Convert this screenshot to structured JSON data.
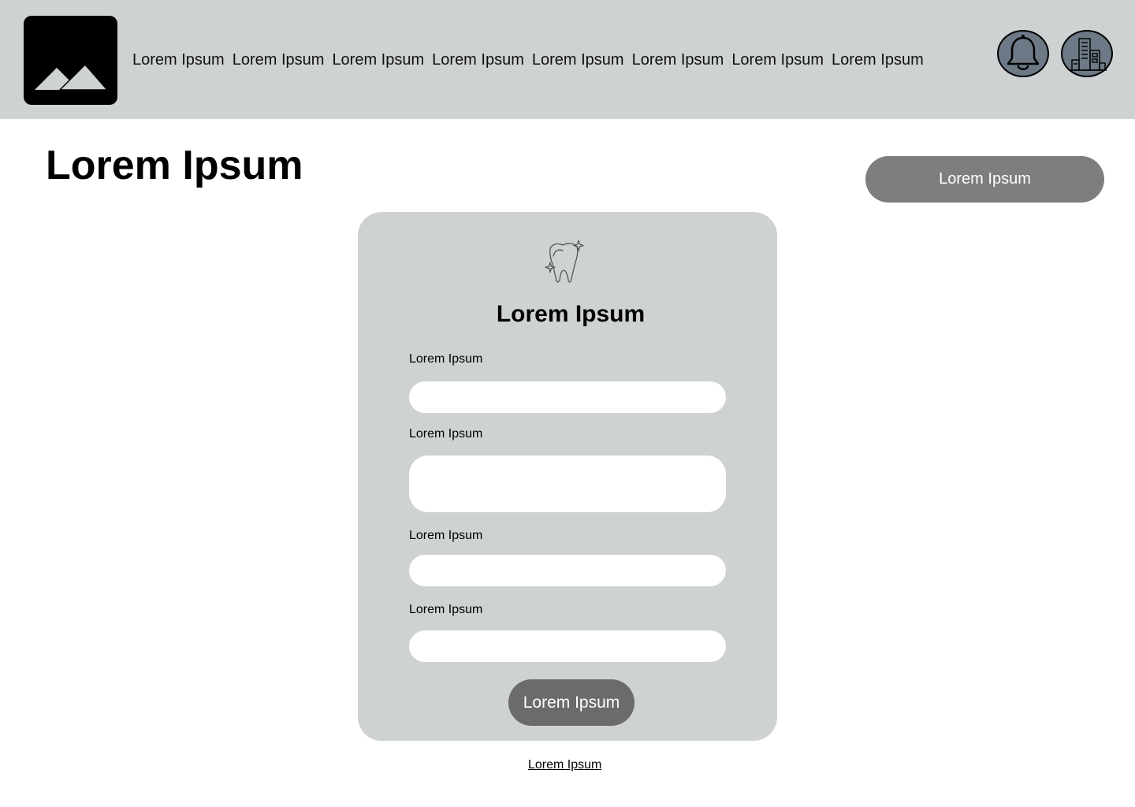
{
  "header": {
    "logo_icon": "image-placeholder-icon",
    "nav": [
      {
        "label": "Lorem Ipsum"
      },
      {
        "label": "Lorem Ipsum"
      },
      {
        "label": "Lorem Ipsum"
      },
      {
        "label": "Lorem Ipsum"
      },
      {
        "label": "Lorem Ipsum"
      },
      {
        "label": "Lorem Ipsum"
      },
      {
        "label": "Lorem Ipsum"
      },
      {
        "label": "Lorem Ipsum"
      }
    ],
    "notification_icon": "bell-icon",
    "organization_icon": "building-icon"
  },
  "page": {
    "title": "Lorem Ipsum",
    "action_label": "Lorem Ipsum"
  },
  "form": {
    "icon": "tooth-sparkle-icon",
    "title": "Lorem Ipsum",
    "fields": [
      {
        "label": "Lorem Ipsum",
        "value": "",
        "placeholder": ""
      },
      {
        "label": "Lorem Ipsum",
        "value": "",
        "placeholder": ""
      },
      {
        "label": "Lorem Ipsum",
        "value": "",
        "placeholder": ""
      },
      {
        "label": "Lorem Ipsum",
        "value": "",
        "placeholder": ""
      }
    ],
    "submit_label": "Lorem Ipsum"
  },
  "footer": {
    "link_label": "Lorem Ipsum"
  },
  "colors": {
    "header_bg": "#cfd2d2",
    "card_bg": "#cfd2d2",
    "primary_button": "#7e7e7e",
    "submit_button": "#6b6b6b",
    "icon_fill": "#6d7986"
  }
}
